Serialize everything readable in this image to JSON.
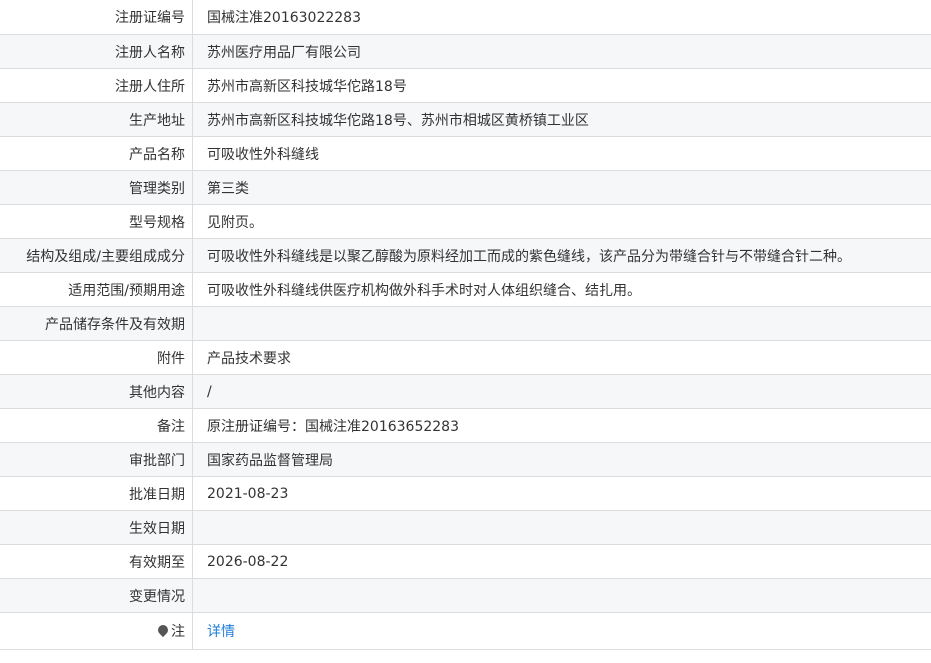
{
  "rows": [
    {
      "label": "注册证编号",
      "value": "国械注准20163022283"
    },
    {
      "label": "注册人名称",
      "value": "苏州医疗用品厂有限公司"
    },
    {
      "label": "注册人住所",
      "value": "苏州市高新区科技城华佗路18号"
    },
    {
      "label": "生产地址",
      "value": "苏州市高新区科技城华佗路18号、苏州市相城区黄桥镇工业区"
    },
    {
      "label": "产品名称",
      "value": "可吸收性外科缝线"
    },
    {
      "label": "管理类别",
      "value": "第三类"
    },
    {
      "label": "型号规格",
      "value": "见附页。"
    },
    {
      "label": "结构及组成/主要组成成分",
      "value": "可吸收性外科缝线是以聚乙醇酸为原料经加工而成的紫色缝线，该产品分为带缝合针与不带缝合针二种。"
    },
    {
      "label": "适用范围/预期用途",
      "value": "可吸收性外科缝线供医疗机构做外科手术时对人体组织缝合、结扎用。"
    },
    {
      "label": "产品储存条件及有效期",
      "value": ""
    },
    {
      "label": "附件",
      "value": "产品技术要求"
    },
    {
      "label": "其他内容",
      "value": "/"
    },
    {
      "label": "备注",
      "value": "原注册证编号：国械注准20163652283"
    },
    {
      "label": "审批部门",
      "value": "国家药品监督管理局"
    },
    {
      "label": "批准日期",
      "value": "2021-08-23"
    },
    {
      "label": "生效日期",
      "value": ""
    },
    {
      "label": "有效期至",
      "value": "2026-08-22"
    },
    {
      "label": "变更情况",
      "value": ""
    }
  ],
  "note": {
    "icon": "pin-icon",
    "label": "注",
    "link_text": "详情"
  },
  "colors": {
    "link": "#1e7ed8",
    "row_alt_bg": "#f6f7f9",
    "border": "#dcdcdc"
  }
}
